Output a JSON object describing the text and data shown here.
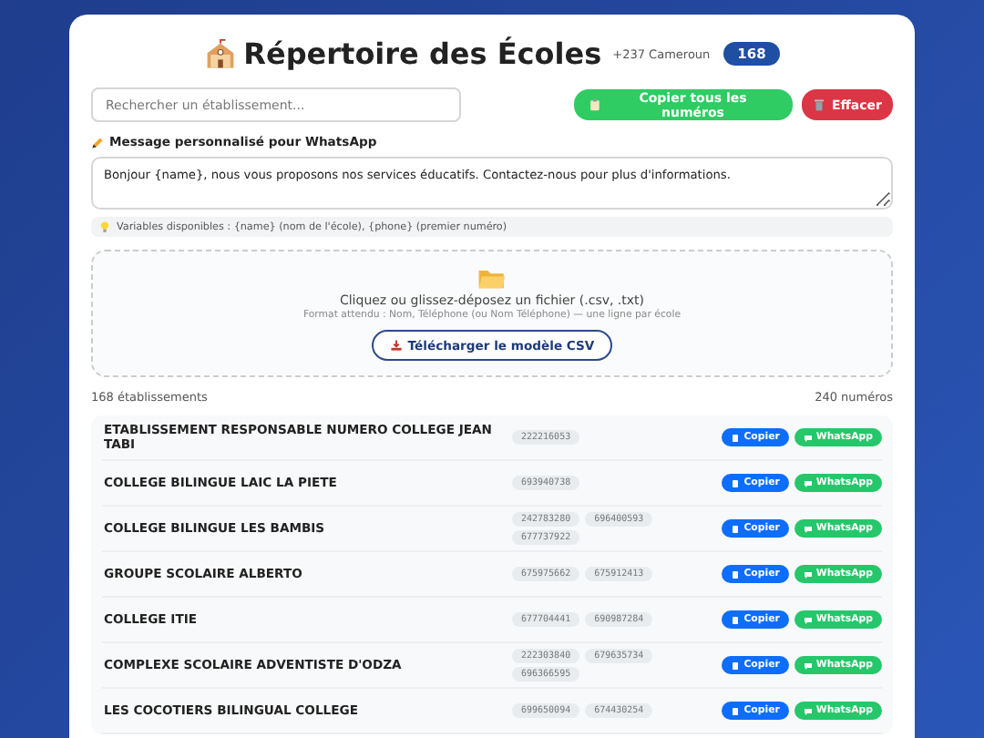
{
  "header": {
    "title": "Répertoire des Écoles",
    "country": "+237 Cameroun",
    "count": "168"
  },
  "search": {
    "placeholder": "Rechercher un établissement..."
  },
  "actions": [
    {
      "kind": "copy",
      "label": "Copier tous les numéros"
    },
    {
      "kind": "clear",
      "label": "Effacer"
    }
  ],
  "message": {
    "label": "Message personnalisé pour WhatsApp",
    "value": "Bonjour {name}, nous vous proposons nos services éducatifs. Contactez-nous pour plus d'informations.",
    "hint": "Variables disponibles : {name} (nom de l'école), {phone} (premier numéro)"
  },
  "dropzone": {
    "title": "Cliquez ou glissez-déposez un fichier (.csv, .txt)",
    "format": "Format attendu : Nom, Téléphone (ou Nom Téléphone) — une ligne par école",
    "button": "Télécharger le modèle CSV"
  },
  "summary": {
    "schools": "168 établissements",
    "numbers": "240 numéros"
  },
  "schools": [
    {
      "name": "ETABLISSEMENT RESPONSABLE NUMERO COLLEGE JEAN TABI",
      "phones": [
        "222216053"
      ],
      "copy": "Copier",
      "whatsapp": "WhatsApp"
    },
    {
      "name": "COLLEGE BILINGUE LAIC LA PIETE",
      "phones": [
        "693940738"
      ],
      "copy": "Copier",
      "whatsapp": "WhatsApp"
    },
    {
      "name": "COLLEGE BILINGUE LES BAMBIS",
      "phones": [
        "242783280",
        "696400593",
        "677737922"
      ],
      "copy": "Copier",
      "whatsapp": "WhatsApp"
    },
    {
      "name": "GROUPE SCOLAIRE ALBERTO",
      "phones": [
        "675975662",
        "675912413"
      ],
      "copy": "Copier",
      "whatsapp": "WhatsApp"
    },
    {
      "name": "COLLEGE ITIE",
      "phones": [
        "677704441",
        "690987284"
      ],
      "copy": "Copier",
      "whatsapp": "WhatsApp"
    },
    {
      "name": "COMPLEXE SCOLAIRE ADVENTISTE D'ODZA",
      "phones": [
        "222303840",
        "679635734",
        "696366595"
      ],
      "copy": "Copier",
      "whatsapp": "WhatsApp"
    },
    {
      "name": "LES COCOTIERS BILINGUAL COLLEGE",
      "phones": [
        "699650094",
        "674430254"
      ],
      "copy": "Copier",
      "whatsapp": "WhatsApp"
    }
  ]
}
